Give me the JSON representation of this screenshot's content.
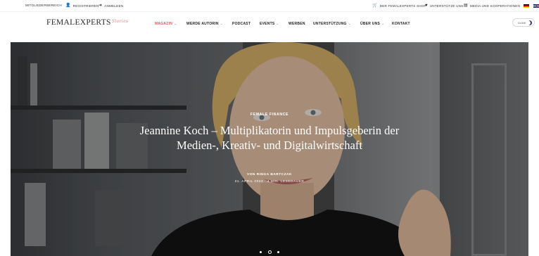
{
  "topbar": {
    "left": [
      {
        "label": "Mitgliederbereich",
        "icon": ""
      },
      {
        "label": "Registrieren",
        "icon": "user-plus-icon"
      },
      {
        "label": "Anmelden",
        "icon": "login-icon"
      }
    ],
    "right": [
      {
        "label": "Der Femalexperts Shop",
        "icon": "cart-icon"
      },
      {
        "label": "Unterstütze uns",
        "icon": "heart-icon"
      },
      {
        "label": "Media und Kooperationen",
        "icon": "newspaper-icon"
      }
    ],
    "languages": [
      "de",
      "en"
    ]
  },
  "header": {
    "logo_text": "FEMALEXPERTS",
    "logo_sub": "Stories",
    "nav": [
      {
        "label": "Magazin",
        "active": true,
        "dropdown": true
      },
      {
        "label": "Werde Autorin",
        "active": false,
        "dropdown": true
      },
      {
        "label": "Podcast",
        "active": false,
        "dropdown": false
      },
      {
        "label": "Events",
        "active": false,
        "dropdown": true
      },
      {
        "label": "Werben",
        "active": false,
        "dropdown": false
      },
      {
        "label": "Unterstützung",
        "active": false,
        "dropdown": true
      },
      {
        "label": "Über uns",
        "active": false,
        "dropdown": true
      },
      {
        "label": "Kontakt",
        "active": false,
        "dropdown": false
      }
    ],
    "toggle_label": "Dunkel",
    "chevron": "⌄"
  },
  "hero": {
    "category": "Female Finance",
    "title": "Jeannine Koch – Multiplikatorin und Impulsgeberin der Medien-, Kreativ- und Digitalwirtschaft",
    "author": "Von Ringa Bartczak",
    "meta": "21. April 2023 · 4 Min. Lesedauer",
    "slides": 3,
    "active_slide": 1
  },
  "colors": {
    "accent": "#e8505b",
    "logo_sub": "#f08a8a",
    "hero_overlay": "rgba(0,0,0,0.28)"
  }
}
